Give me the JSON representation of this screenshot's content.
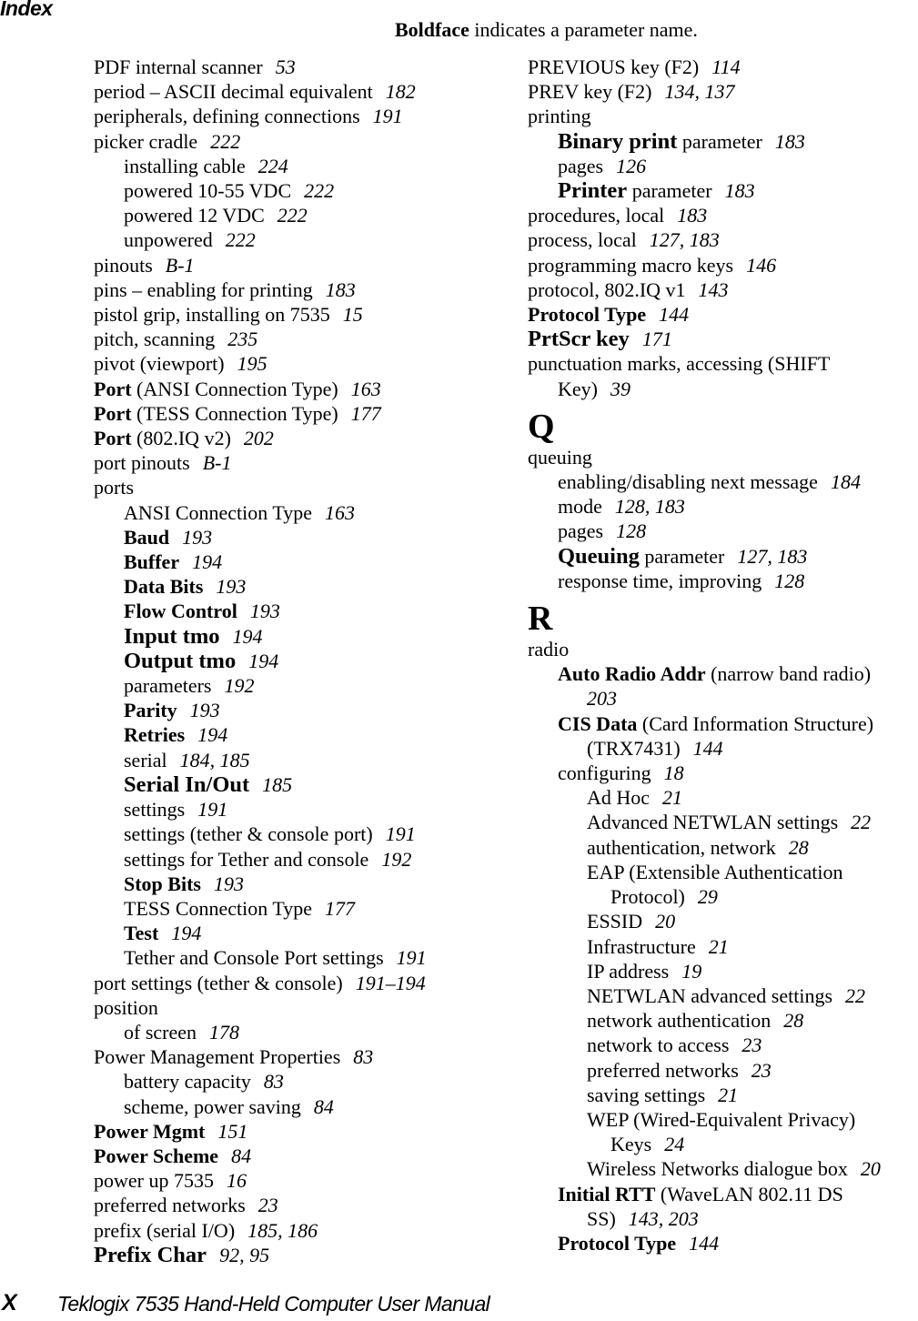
{
  "header": {
    "title": "Index",
    "legend_bold": "Boldface",
    "legend_rest": " indicates a parameter name."
  },
  "left_column": [
    {
      "level": 1,
      "term": "PDF internal scanner",
      "pages": "53"
    },
    {
      "level": 1,
      "term": "period – ASCII decimal equivalent",
      "pages": "182"
    },
    {
      "level": 1,
      "term": "peripherals, defining connections",
      "pages": "191"
    },
    {
      "level": 1,
      "term": "picker cradle",
      "pages": "222"
    },
    {
      "level": 2,
      "term": "installing cable",
      "pages": "224"
    },
    {
      "level": 2,
      "term": "powered 10-55 VDC",
      "pages": "222"
    },
    {
      "level": 2,
      "term": "powered 12 VDC",
      "pages": "222"
    },
    {
      "level": 2,
      "term": "unpowered",
      "pages": "222"
    },
    {
      "level": 1,
      "term": "pinouts",
      "pages": "B-1"
    },
    {
      "level": 1,
      "term": "pins – enabling for printing",
      "pages": "183"
    },
    {
      "level": 1,
      "term": "pistol grip, installing on 7535",
      "pages": "15"
    },
    {
      "level": 1,
      "term": "pitch, scanning",
      "pages": "235"
    },
    {
      "level": 1,
      "term": "pivot (viewport)",
      "pages": "195"
    },
    {
      "level": 1,
      "bold": "Port",
      "term": " (ANSI Connection Type)",
      "pages": "163"
    },
    {
      "level": 1,
      "bold": "Port",
      "term": " (TESS Connection Type)",
      "pages": "177"
    },
    {
      "level": 1,
      "bold": "Port",
      "term": " (802.IQ v2)",
      "pages": "202"
    },
    {
      "level": 1,
      "term": "port pinouts",
      "pages": "B-1"
    },
    {
      "level": 1,
      "term": "ports",
      "pages": ""
    },
    {
      "level": 2,
      "term": "ANSI Connection Type",
      "pages": "163"
    },
    {
      "level": 2,
      "bold": "Baud",
      "term": "",
      "pages": "193"
    },
    {
      "level": 2,
      "bold": "Buffer",
      "term": "",
      "pages": "194"
    },
    {
      "level": 2,
      "bold": "Data Bits",
      "term": "",
      "pages": "193"
    },
    {
      "level": 2,
      "bold": "Flow Control",
      "term": "",
      "pages": "193"
    },
    {
      "level": 2,
      "bold": "Input tmo",
      "big": true,
      "term": "",
      "pages": "194"
    },
    {
      "level": 2,
      "bold": "Output tmo",
      "big": true,
      "term": "",
      "pages": "194"
    },
    {
      "level": 2,
      "term": "parameters",
      "pages": "192"
    },
    {
      "level": 2,
      "bold": "Parity",
      "term": "",
      "pages": "193"
    },
    {
      "level": 2,
      "bold": "Retries",
      "term": "",
      "pages": "194"
    },
    {
      "level": 2,
      "term": "serial",
      "pages": "184, 185"
    },
    {
      "level": 2,
      "bold": "Serial In/Out",
      "big": true,
      "term": "",
      "pages": "185"
    },
    {
      "level": 2,
      "term": "settings",
      "pages": "191"
    },
    {
      "level": 2,
      "term": "settings (tether & console port)",
      "pages": "191"
    },
    {
      "level": 2,
      "term": "settings for Tether and console",
      "pages": "192"
    },
    {
      "level": 2,
      "bold": "Stop Bits",
      "term": "",
      "pages": "193"
    },
    {
      "level": 2,
      "term": "TESS Connection Type",
      "pages": "177"
    },
    {
      "level": 2,
      "bold": "Test",
      "term": "",
      "pages": "194"
    },
    {
      "level": 2,
      "term": "Tether and Console Port settings",
      "pages": "191"
    },
    {
      "level": 1,
      "term": "port settings (tether & console)",
      "pages": "191–194"
    },
    {
      "level": 1,
      "term": "position",
      "pages": ""
    },
    {
      "level": 2,
      "term": "of screen",
      "pages": "178"
    },
    {
      "level": 1,
      "term": "Power Management Properties",
      "pages": "83"
    },
    {
      "level": 2,
      "term": "battery capacity",
      "pages": "83"
    },
    {
      "level": 2,
      "term": "scheme, power saving",
      "pages": "84"
    },
    {
      "level": 1,
      "bold": "Power Mgmt",
      "term": "",
      "pages": "151"
    },
    {
      "level": 1,
      "bold": "Power Scheme",
      "term": "",
      "pages": "84"
    },
    {
      "level": 1,
      "term": "power up 7535",
      "pages": "16"
    },
    {
      "level": 1,
      "term": "preferred networks",
      "pages": "23"
    },
    {
      "level": 1,
      "term": "prefix (serial I/O)",
      "pages": "185, 186"
    },
    {
      "level": 1,
      "bold": "Prefix Char",
      "big": true,
      "term": "",
      "pages": "92, 95"
    }
  ],
  "right_column": [
    {
      "level": 1,
      "term": "PREVIOUS key (F2)",
      "pages": "114"
    },
    {
      "level": 1,
      "term": "PREV key (F2)",
      "pages": "134, 137"
    },
    {
      "level": 1,
      "term": "printing",
      "pages": ""
    },
    {
      "level": 2,
      "bold": "Binary print",
      "big": true,
      "term": " parameter",
      "pages": "183"
    },
    {
      "level": 2,
      "term": "pages",
      "pages": "126"
    },
    {
      "level": 2,
      "bold": "Printer",
      "big": true,
      "term": " parameter",
      "pages": "183"
    },
    {
      "level": 1,
      "term": "procedures, local",
      "pages": "183"
    },
    {
      "level": 1,
      "term": "process, local",
      "pages": "127, 183"
    },
    {
      "level": 1,
      "term": "programming macro keys",
      "pages": "146"
    },
    {
      "level": 1,
      "term": "protocol, 802.IQ v1",
      "pages": "143"
    },
    {
      "level": 1,
      "bold": "Protocol Type",
      "term": "",
      "pages": "144"
    },
    {
      "level": 1,
      "bold": "PrtScr key",
      "big": true,
      "term": "",
      "pages": "171"
    },
    {
      "level": 1,
      "term": "punctuation marks, accessing (SHIFT",
      "pages": ""
    },
    {
      "level": 2,
      "term": "Key)",
      "pages": "39"
    },
    {
      "section": "Q"
    },
    {
      "level": 1,
      "term": "queuing",
      "pages": ""
    },
    {
      "level": 2,
      "term": "enabling/disabling next message",
      "pages": "184"
    },
    {
      "level": 2,
      "term": "mode",
      "pages": "128, 183"
    },
    {
      "level": 2,
      "term": "pages",
      "pages": "128"
    },
    {
      "level": 2,
      "bold": "Queuing",
      "big": true,
      "term": " parameter",
      "pages": "127, 183"
    },
    {
      "level": 2,
      "term": "response time, improving",
      "pages": "128"
    },
    {
      "section": "R"
    },
    {
      "level": 1,
      "term": "radio",
      "pages": ""
    },
    {
      "level": 2,
      "bold": "Auto Radio Addr",
      "term": " (narrow band radio)",
      "pages": ""
    },
    {
      "level": 3,
      "term": "",
      "pages": "203"
    },
    {
      "level": 2,
      "bold": "CIS Data",
      "term": " (Card Information Structure)",
      "pages": ""
    },
    {
      "level": 3,
      "term": "(TRX7431)",
      "pages": "144"
    },
    {
      "level": 2,
      "term": "configuring",
      "pages": "18"
    },
    {
      "level": 3,
      "term": "Ad Hoc",
      "pages": "21"
    },
    {
      "level": 3,
      "term": "Advanced NETWLAN settings",
      "pages": "22"
    },
    {
      "level": 3,
      "term": "authentication, network",
      "pages": "28"
    },
    {
      "level": 3,
      "term": "EAP (Extensible Authentication",
      "pages": ""
    },
    {
      "level": 4,
      "term": "Protocol)",
      "pages": "29"
    },
    {
      "level": 3,
      "term": "ESSID",
      "pages": "20"
    },
    {
      "level": 3,
      "term": "Infrastructure",
      "pages": "21"
    },
    {
      "level": 3,
      "term": "IP address",
      "pages": "19"
    },
    {
      "level": 3,
      "term": "NETWLAN advanced settings",
      "pages": "22"
    },
    {
      "level": 3,
      "term": "network authentication",
      "pages": "28"
    },
    {
      "level": 3,
      "term": "network to access",
      "pages": "23"
    },
    {
      "level": 3,
      "term": "preferred networks",
      "pages": "23"
    },
    {
      "level": 3,
      "term": "saving settings",
      "pages": "21"
    },
    {
      "level": 3,
      "term": "WEP (Wired-Equivalent Privacy)",
      "pages": ""
    },
    {
      "level": 4,
      "term": "Keys",
      "pages": "24"
    },
    {
      "level": 3,
      "term": "Wireless Networks dialogue box",
      "pages": "20"
    },
    {
      "level": 2,
      "bold": "Initial RTT",
      "term": " (WaveLAN 802.11 DS",
      "pages": ""
    },
    {
      "level": 3,
      "term": "SS)",
      "pages": "143, 203"
    },
    {
      "level": 2,
      "bold": "Protocol Type",
      "term": "",
      "pages": "144"
    }
  ],
  "footer": {
    "page_number": "X",
    "manual_title": "Teklogix 7535 Hand-Held Computer User Manual"
  }
}
